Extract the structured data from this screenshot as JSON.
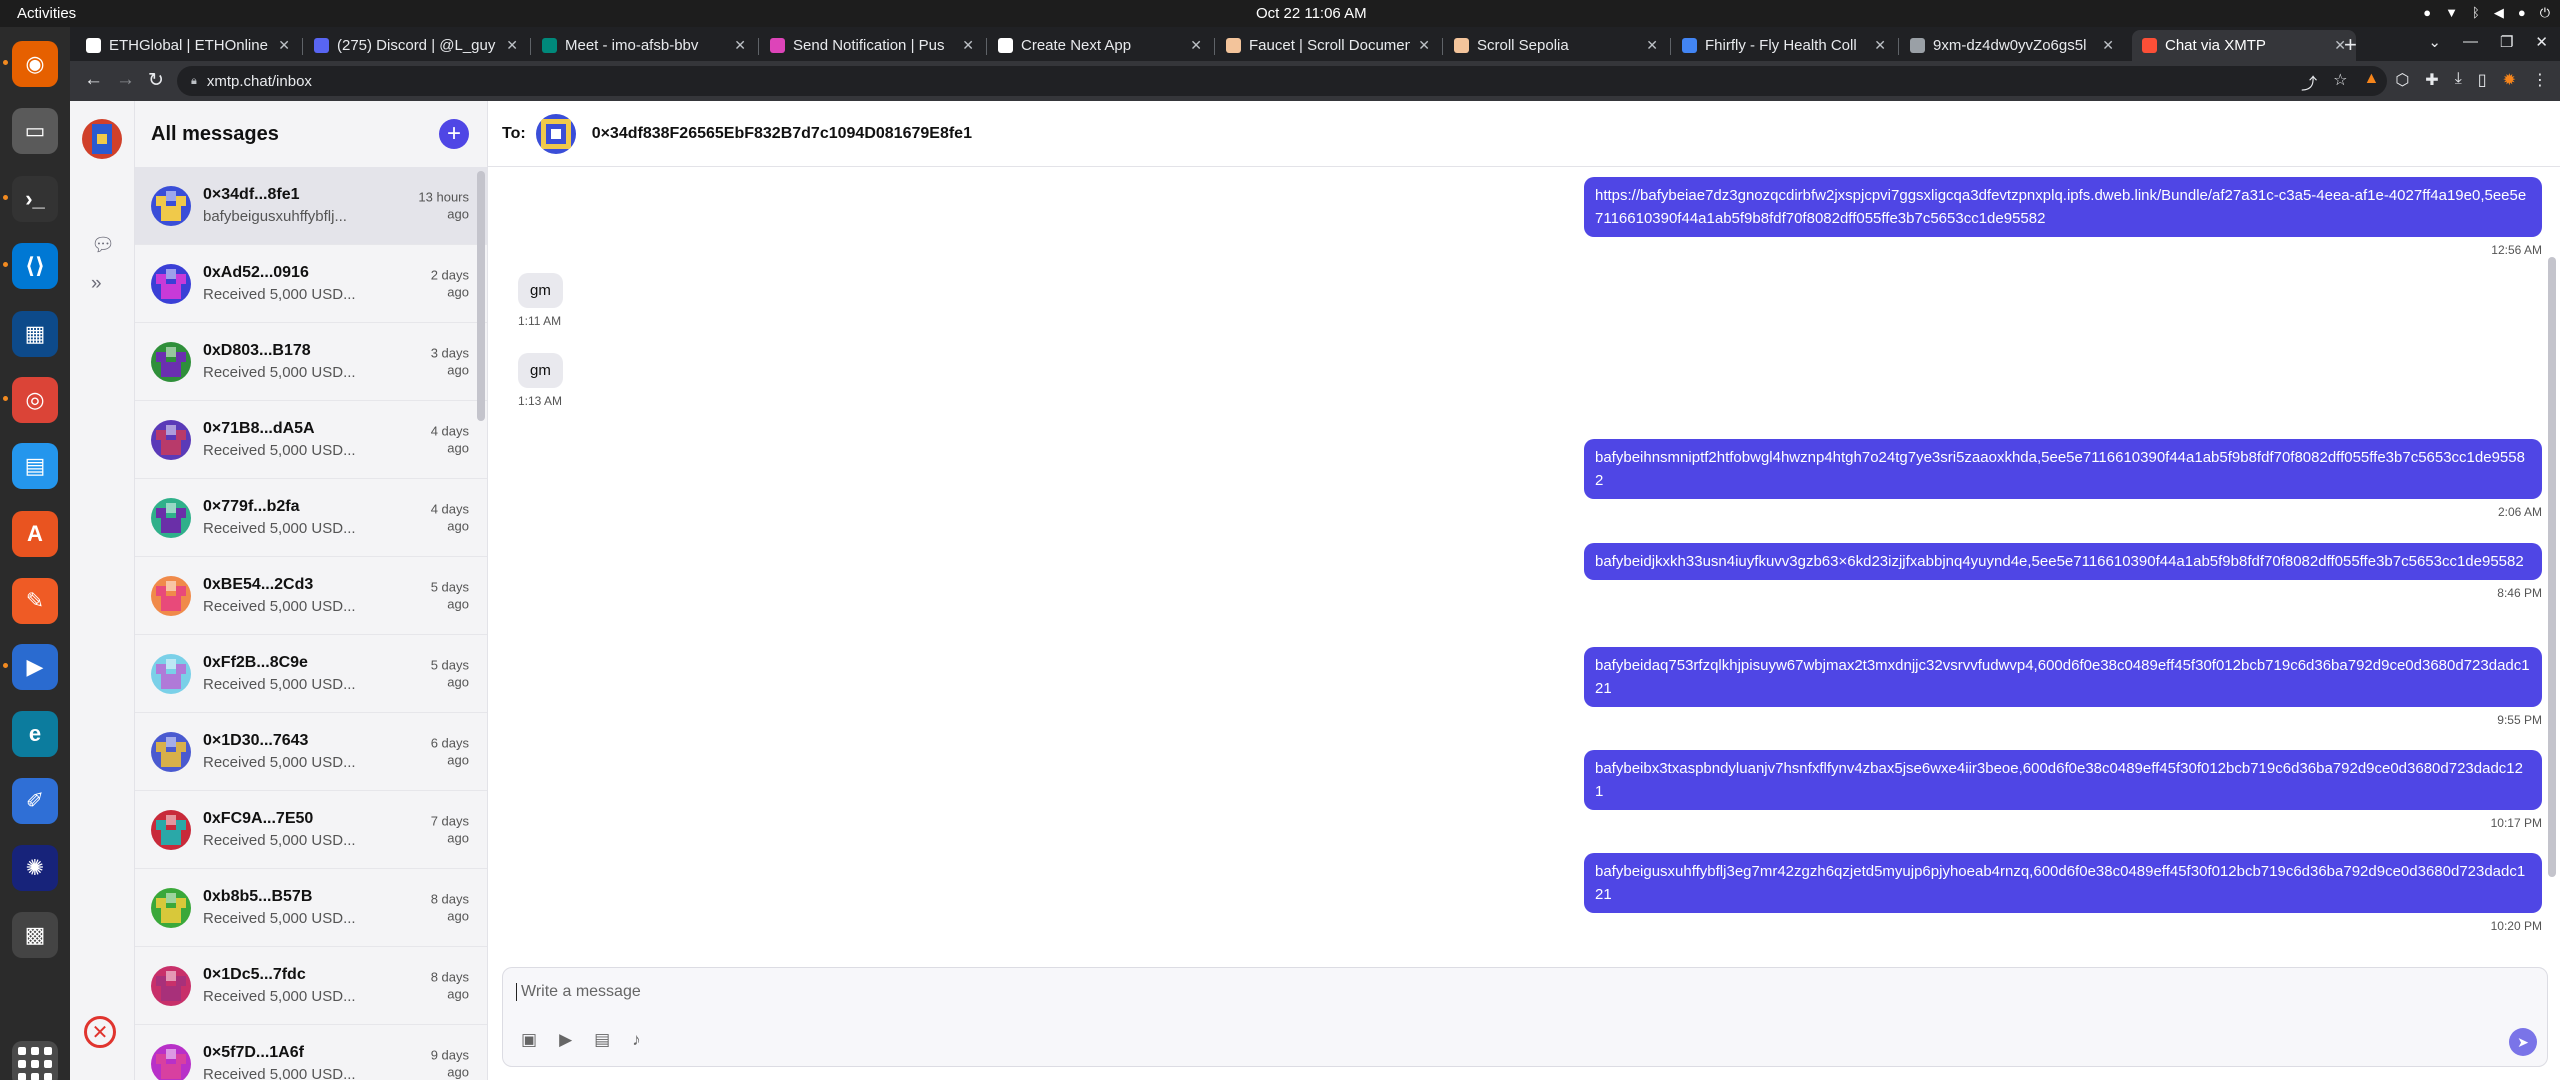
{
  "system": {
    "activities": "Activities",
    "clock": "Oct 22  11:06 AM"
  },
  "browser": {
    "tabs": [
      {
        "title": "ETHGlobal | ETHOnline",
        "color": "#ffffff"
      },
      {
        "title": "(275) Discord | @L_guy",
        "color": "#5865f2"
      },
      {
        "title": "Meet - imo-afsb-bbv",
        "color": "#00897b"
      },
      {
        "title": "Send Notification | Pus",
        "color": "#dd44b9"
      },
      {
        "title": "Create Next App",
        "color": "#ffffff"
      },
      {
        "title": "Faucet | Scroll Documen",
        "color": "#f3c49b"
      },
      {
        "title": "Scroll Sepolia",
        "color": "#f3c49b"
      },
      {
        "title": "Fhirfly - Fly Health Coll",
        "color": "#4285f4"
      },
      {
        "title": "9xm-dz4dw0yvZo6gs5l",
        "color": "#9aa0a6"
      },
      {
        "title": "Chat via XMTP",
        "color": "#fc4f37"
      }
    ],
    "url": "xmtp.chat/inbox"
  },
  "inbox": {
    "title": "All messages",
    "conversations": [
      {
        "name": "0×34df...8fe1",
        "preview": "bafybeigusxuhffybflj...",
        "time": "13 hours ago",
        "colors": [
          "#3a4ed8",
          "#f0c94a"
        ]
      },
      {
        "name": "0xAd52...0916",
        "preview": "Received 5,000 USD...",
        "time": "2 days ago",
        "colors": [
          "#3a3fd6",
          "#c83ad8"
        ]
      },
      {
        "name": "0xD803...B178",
        "preview": "Received 5,000 USD...",
        "time": "3 days ago",
        "colors": [
          "#2f8f3a",
          "#6b2fb0"
        ]
      },
      {
        "name": "0×71B8...dA5A",
        "preview": "Received 5,000 USD...",
        "time": "4 days ago",
        "colors": [
          "#5a3ab8",
          "#b83a6a"
        ]
      },
      {
        "name": "0×779f...b2fa",
        "preview": "Received 5,000 USD...",
        "time": "4 days ago",
        "colors": [
          "#2fb08a",
          "#6a2fa8"
        ]
      },
      {
        "name": "0xBE54...2Cd3",
        "preview": "Received 5,000 USD...",
        "time": "5 days ago",
        "colors": [
          "#f08a4a",
          "#e84a7a"
        ]
      },
      {
        "name": "0xFf2B...8C9e",
        "preview": "Received 5,000 USD...",
        "time": "5 days ago",
        "colors": [
          "#7ad0e8",
          "#b07ad8"
        ]
      },
      {
        "name": "0×1D30...7643",
        "preview": "Received 5,000 USD...",
        "time": "6 days ago",
        "colors": [
          "#4a5ad0",
          "#d8b04a"
        ]
      },
      {
        "name": "0xFC9A...7E50",
        "preview": "Received 5,000 USD...",
        "time": "7 days ago",
        "colors": [
          "#c82a3a",
          "#2aa8a8"
        ]
      },
      {
        "name": "0xb8b5...B57B",
        "preview": "Received 5,000 USD...",
        "time": "8 days ago",
        "colors": [
          "#3aa83a",
          "#d8c83a"
        ]
      },
      {
        "name": "0×1Dc5...7fdc",
        "preview": "Received 5,000 USD...",
        "time": "8 days ago",
        "colors": [
          "#c8306a",
          "#a8307a"
        ]
      },
      {
        "name": "0×5f7D...1A6f",
        "preview": "Received 5,000 USD...",
        "time": "9 days ago",
        "colors": [
          "#b830c8",
          "#d840a0"
        ]
      }
    ]
  },
  "chat": {
    "to_label": "To:",
    "address": "0×34df838F26565EbF832B7d7c1094D081679E8fe1",
    "messages": [
      {
        "dir": "out",
        "text": "https://bafybeiae7dz3gnozqcdirbfw2jxspjcpvi7ggsxligcqa3dfevtzpnxplq.ipfs.dweb.link/Bundle/af27a31c-c3a5-4eea-af1e-4027ff4a19e0,5ee5e7116610390f44a1ab5f9b8fdf70f8082dff055ffe3b7c5653cc1de95582",
        "time": "12:56 AM"
      },
      {
        "dir": "in",
        "text": "gm",
        "time": "1:11 AM"
      },
      {
        "dir": "in",
        "text": "gm",
        "time": "1:13 AM"
      },
      {
        "dir": "out",
        "text": "bafybeihnsmniptf2htfobwgl4hwznp4htgh7o24tg7ye3sri5zaaoxkhda,5ee5e7116610390f44a1ab5f9b8fdf70f8082dff055ffe3b7c5653cc1de95582",
        "time": "2:06 AM"
      },
      {
        "dir": "out",
        "text": "bafybeidjkxkh33usn4iuyfkuvv3gzb63×6kd23izjjfxabbjnq4yuynd4e,5ee5e7116610390f44a1ab5f9b8fdf70f8082dff055ffe3b7c5653cc1de95582",
        "time": "8:46 PM"
      },
      {
        "dir": "out",
        "text": "bafybeidaq753rfzqlkhjpisuyw67wbjmax2t3mxdnjjc32vsrvvfudwvp4,600d6f0e38c0489eff45f30f012bcb719c6d36ba792d9ce0d3680d723dadc121",
        "time": "9:55 PM"
      },
      {
        "dir": "out",
        "text": "bafybeibx3txaspbndyluanjv7hsnfxflfynv4zbax5jse6wxe4iir3beoe,600d6f0e38c0489eff45f30f012bcb719c6d36ba792d9ce0d3680d723dadc121",
        "time": "10:17 PM"
      },
      {
        "dir": "out",
        "text": "bafybeigusxuhffybflj3eg7mr42zgzh6qzjetd5myujp6pjyhoeab4rnzq,600d6f0e38c0489eff45f30f012bcb719c6d36ba792d9ce0d3680d723dadc121",
        "time": "10:20 PM"
      }
    ],
    "composer_placeholder": "Write a message"
  },
  "colors": {
    "accent": "#4f46e5"
  }
}
